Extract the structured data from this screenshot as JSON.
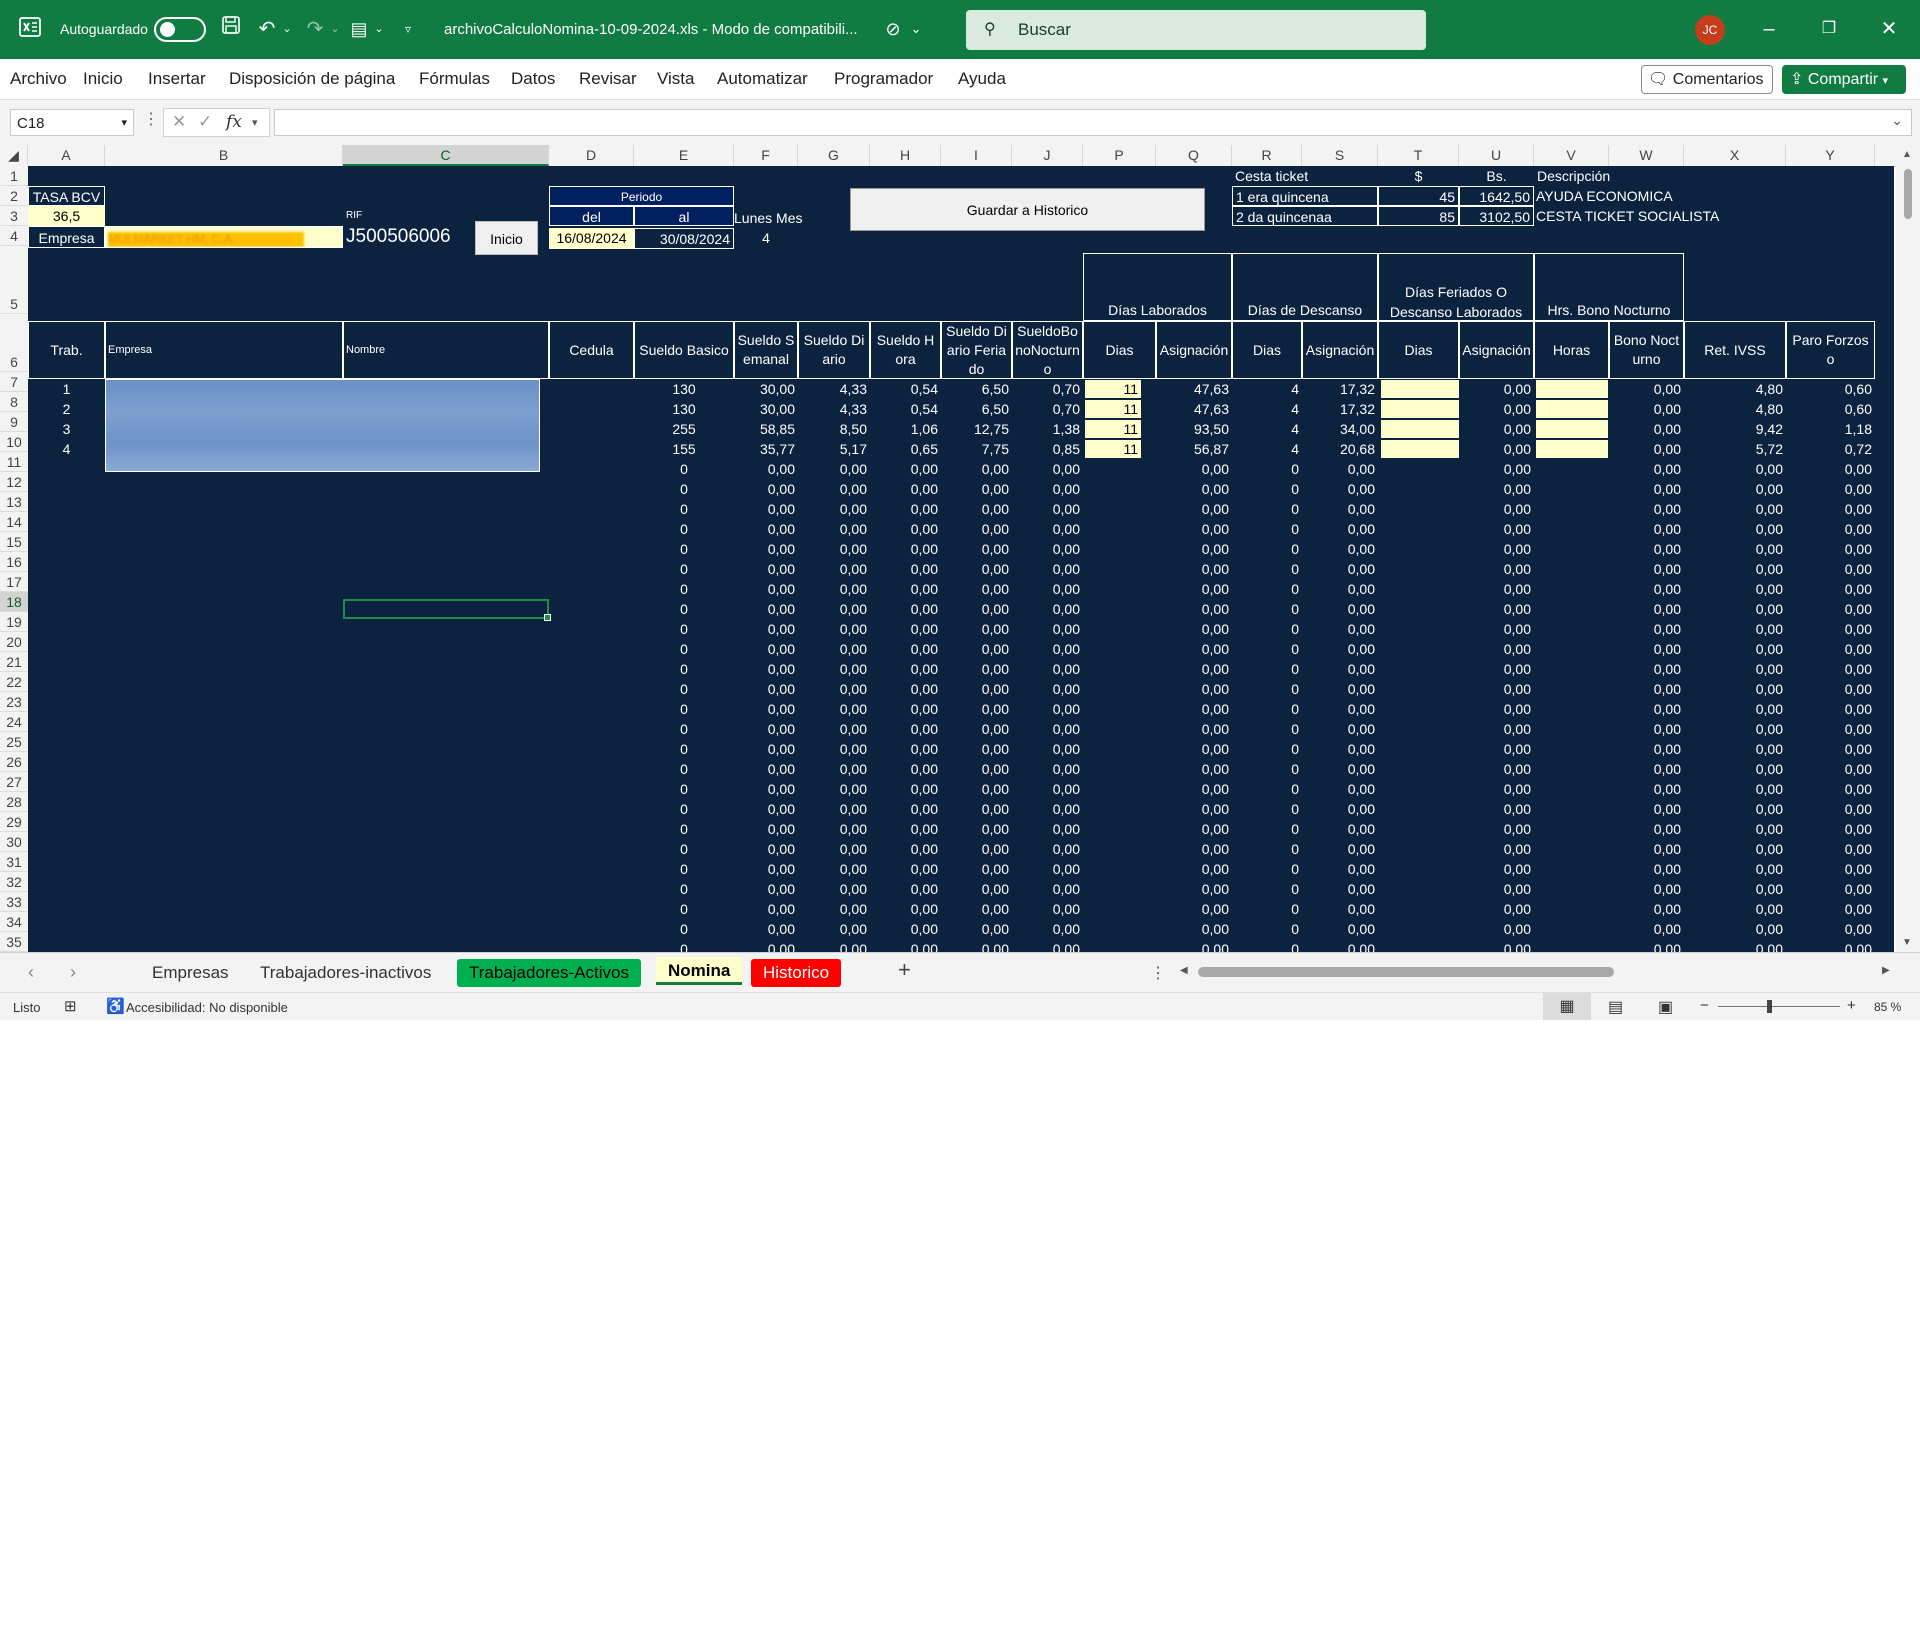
{
  "titlebar": {
    "autosave_label": "Autoguardado",
    "doc_title": "archivoCalculoNomina-10-09-2024.xls  -  Modo de compatibili...",
    "search_placeholder": "Buscar",
    "avatar_initials": "JC"
  },
  "menu": {
    "items": [
      "Archivo",
      "Inicio",
      "Insertar",
      "Disposición de página",
      "Fórmulas",
      "Datos",
      "Revisar",
      "Vista",
      "Automatizar",
      "Programador",
      "Ayuda"
    ],
    "comments_label": "Comentarios",
    "share_label": "Compartir"
  },
  "formula_bar": {
    "name_box": "C18",
    "fx": "fx",
    "content": ""
  },
  "columns": [
    "A",
    "B",
    "C",
    "D",
    "E",
    "F",
    "G",
    "H",
    "I",
    "J",
    "P",
    "Q",
    "R",
    "S",
    "T",
    "U",
    "V",
    "W",
    "X",
    "Y"
  ],
  "selected_column": "C",
  "selected_row": "18",
  "row_numbers": [
    "1",
    "2",
    "3",
    "4",
    "5",
    "6",
    "7",
    "8",
    "9",
    "10",
    "11",
    "12",
    "13",
    "14",
    "15",
    "16",
    "17",
    "18",
    "19",
    "20",
    "21",
    "22",
    "23",
    "24",
    "25",
    "26",
    "27",
    "28",
    "29",
    "30",
    "31",
    "32",
    "33",
    "34",
    "35"
  ],
  "top": {
    "tasa_label": "TASA BCV",
    "tasa_value": "36,5",
    "empresa_label": "Empresa",
    "empresa_value": "MULMARKET HM, C.A.",
    "rif_label": "RIF",
    "rif_value": "J500506006",
    "inicio_button": "Inicio",
    "periodo_label": "Periodo",
    "del_label": "del",
    "al_label": "al",
    "del_value": "16/08/2024",
    "al_value": "30/08/2024",
    "lunes_label": "Lunes Mes",
    "lunes_value": "4",
    "guardar_button": "Guardar a Historico",
    "cesta_title": "Cesta ticket",
    "usd_header": "$",
    "bs_header": "Bs.",
    "desc_header": "Descripción",
    "cesta_rows": [
      {
        "label": "1 era quincena",
        "usd": "45",
        "bs": "1642,50",
        "desc": "AYUDA ECONOMICA"
      },
      {
        "label": "2 da quincenaa",
        "usd": "85",
        "bs": "3102,50",
        "desc": "CESTA TICKET SOCIALISTA"
      }
    ]
  },
  "group_headers": {
    "dias_laborados": "Días Laborados",
    "dias_descanso": "Días de Descanso",
    "feriados": "Días Feriados O Descanso Laborados",
    "bono_nocturno": "Hrs. Bono Nocturno"
  },
  "headers": {
    "trab": "Trab.",
    "empresa": "Empresa",
    "nombre": "Nombre",
    "cedula": "Cedula",
    "sueldo_basico": "Sueldo Basico",
    "sueldo_semanal": "Sueldo Semanal",
    "sueldo_diario": "Sueldo Diario",
    "sueldo_hora": "Sueldo Hora",
    "sueldo_diario_feriado": "Sueldo Diario Feriado",
    "sueldo_bono_nocturno": "SueldoBonoNocturno",
    "dias": "Dias",
    "asignacion": "Asignación",
    "horas": "Horas",
    "bono_nocturno": "Bono Nocturno",
    "ret_ivss": "Ret. IVSS",
    "paro_forzoso": "Paro Forzoso"
  },
  "workers": [
    {
      "trab": "1",
      "basico": "130",
      "semanal": "30,00",
      "diario": "4,33",
      "hora": "0,54",
      "feriado": "6,50",
      "nocturno": "0,70",
      "dias_lab": "11",
      "asig_lab": "47,63",
      "dias_desc": "4",
      "asig_desc": "17,32",
      "asig_fer": "0,00",
      "bono": "0,00",
      "ivss": "4,80",
      "paro": "0,60"
    },
    {
      "trab": "2",
      "basico": "130",
      "semanal": "30,00",
      "diario": "4,33",
      "hora": "0,54",
      "feriado": "6,50",
      "nocturno": "0,70",
      "dias_lab": "11",
      "asig_lab": "47,63",
      "dias_desc": "4",
      "asig_desc": "17,32",
      "asig_fer": "0,00",
      "bono": "0,00",
      "ivss": "4,80",
      "paro": "0,60"
    },
    {
      "trab": "3",
      "basico": "255",
      "semanal": "58,85",
      "diario": "8,50",
      "hora": "1,06",
      "feriado": "12,75",
      "nocturno": "1,38",
      "dias_lab": "11",
      "asig_lab": "93,50",
      "dias_desc": "4",
      "asig_desc": "34,00",
      "asig_fer": "0,00",
      "bono": "0,00",
      "ivss": "9,42",
      "paro": "1,18"
    },
    {
      "trab": "4",
      "basico": "155",
      "semanal": "35,77",
      "diario": "5,17",
      "hora": "0,65",
      "feriado": "7,75",
      "nocturno": "0,85",
      "dias_lab": "11",
      "asig_lab": "56,87",
      "dias_desc": "4",
      "asig_desc": "20,68",
      "asig_fer": "0,00",
      "bono": "0,00",
      "ivss": "5,72",
      "paro": "0,72"
    }
  ],
  "empty_row": {
    "basico": "0",
    "semanal": "0,00",
    "diario": "0,00",
    "hora": "0,00",
    "feriado": "0,00",
    "nocturno": "0,00",
    "asig_lab": "0,00",
    "dias_desc": "0",
    "asig_desc": "0,00",
    "asig_fer": "0,00",
    "bono": "0,00",
    "ivss": "0,00",
    "paro": "0,00"
  },
  "tabs": [
    {
      "label": "Empresas",
      "style": "plain"
    },
    {
      "label": "Trabajadores-inactivos",
      "style": "plain"
    },
    {
      "label": "Trabajadores-Activos",
      "style": "green"
    },
    {
      "label": "Nomina",
      "style": "active"
    },
    {
      "label": "Historico",
      "style": "red"
    }
  ],
  "status": {
    "ready": "Listo",
    "accessibility": "Accesibilidad: No disponible",
    "zoom": "85 %"
  },
  "colors": {
    "excel_green": "#107c41",
    "sheet_bg": "#0c2340",
    "input_yellow": "#ffffcc",
    "tab_red": "#ff0000",
    "tab_green": "#00b050"
  }
}
